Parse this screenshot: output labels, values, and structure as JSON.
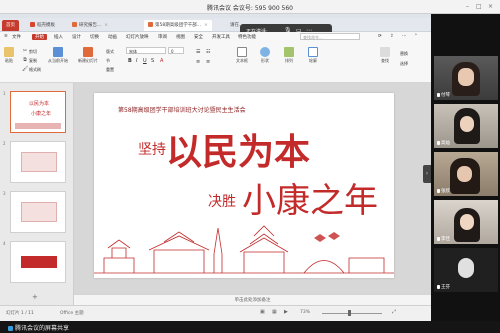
{
  "meeting": {
    "title": "腾讯会议 会议号: 595 900 560",
    "sharing_label": "正在讲话:",
    "screen_share_hint": "结束共享"
  },
  "wps": {
    "tabs": [
      {
        "label": "稻壳模板"
      },
      {
        "label": "研究报告..."
      },
      {
        "label": "第58期高级团学干部..."
      },
      {
        "label": "请在..."
      }
    ],
    "menus": [
      "文件",
      "开始",
      "插入",
      "设计",
      "切换",
      "动画",
      "幻灯片放映",
      "审阅",
      "视图",
      "安全",
      "开发工具",
      "特色功能"
    ],
    "active_menu": "开始",
    "ribbon": {
      "paste": "粘贴",
      "cut": "剪切",
      "copy": "复制",
      "format_painter": "格式刷",
      "start_from_current": "从当前开始",
      "new_slide": "新建幻灯片",
      "layout": "版式",
      "section": "节",
      "reset": "重置",
      "font_name": "宋体",
      "font_size": "0",
      "text_box": "文本框",
      "shape": "形状",
      "arrange": "排列",
      "outline": "轮廓",
      "find": "查找",
      "replace": "替换",
      "select": "选择",
      "search_placeholder": "查找命令..."
    },
    "slide": {
      "header": "第58期高级团学干部培训班大讨论暨民主生活会",
      "line1_small": "坚持",
      "line1_big": "以民为本",
      "line2_small": "决胜",
      "line2_big": "小康之年"
    },
    "thumbnails": [
      {
        "num": "1",
        "line1": "以民为本",
        "line2": "小康之年"
      },
      {
        "num": "2",
        "line1": "",
        "line2": ""
      },
      {
        "num": "3",
        "line1": "",
        "line2": ""
      },
      {
        "num": "4",
        "line1": "",
        "line2": ""
      }
    ],
    "notes_placeholder": "单击此处添加备注",
    "status_left": "幻灯片 1 / 11",
    "status_theme": "Office 主题",
    "status_zoom": "73%"
  },
  "participants": [
    {
      "name": "付琴"
    },
    {
      "name": "高灿"
    },
    {
      "name": "张欣"
    },
    {
      "name": "李佳"
    },
    {
      "name": "王芬"
    }
  ],
  "bottom_bar": {
    "label": "腾讯会议的屏幕共享"
  },
  "colors": {
    "accent": "#c53c2e",
    "slide_red": "#c32a2a"
  }
}
